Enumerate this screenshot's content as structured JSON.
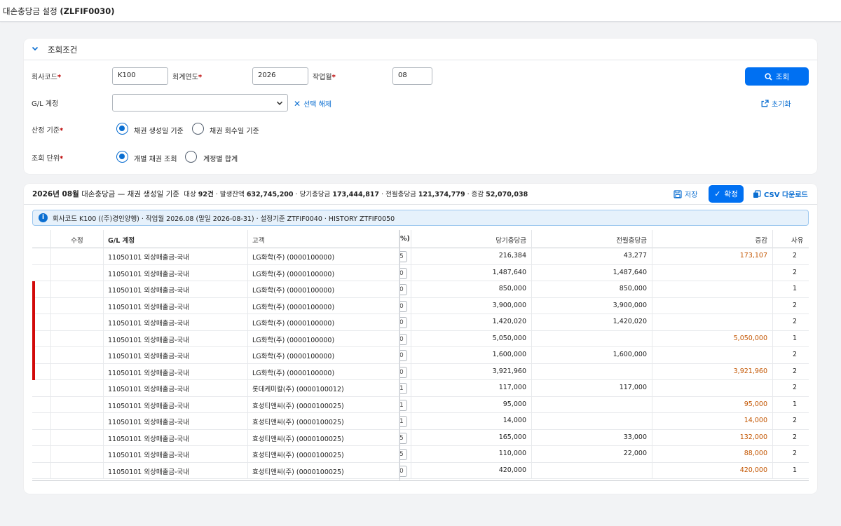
{
  "shell": {
    "title": "대손충당금 설정",
    "code": "(ZLFIF0030)"
  },
  "filter": {
    "header": "조회조건",
    "company_label": "회사코드",
    "company_value": "K100",
    "year_label": "회계연도",
    "year_value": "2026",
    "month_label": "작업월",
    "month_value": "08",
    "gl_label": "G/L 계정",
    "gl_value": "",
    "clear_label": "선택 해제",
    "search_label": "조회",
    "reset_label": "초기화",
    "basis_label": "산정 기준",
    "basis_options": [
      "채권 생성일 기준",
      "채권 회수일 기준"
    ],
    "basis_selected": 0,
    "unit_label": "조회 단위",
    "unit_options": [
      "개별 채권 조회",
      "계정별 합계"
    ],
    "unit_selected": 0
  },
  "result": {
    "title_month": "2026년 08월",
    "title_rest": " 대손충당금 — 채권 생성일 기준",
    "summary": [
      {
        "label": "대상",
        "value": "92건"
      },
      {
        "label": "발생잔액",
        "value": "632,745,200"
      },
      {
        "label": "당기충당금",
        "value": "173,444,817"
      },
      {
        "label": "전월충당금",
        "value": "121,374,779"
      },
      {
        "label": "증감",
        "value": "52,070,038"
      }
    ],
    "save_label": "저장",
    "confirm_label": "확정",
    "csv_label": "CSV 다운로드",
    "info": "회사코드 K100 ((주)경인양행) · 작업월 2026.08 (말일 2026-08-31) · 설정기준 ZTFIF0040 · HISTORY ZTFIF0050",
    "columns": {
      "edit": "수정",
      "gl": "G/L 계정",
      "customer": "고객",
      "pct": "%)",
      "current": "당기충당금",
      "prev": "전월충당금",
      "diff": "증감",
      "reason": "사유"
    },
    "rows": [
      {
        "gl": "11050101 외상매출금-국내",
        "customer": "LG화학(주) (0000100000)",
        "pct": "5",
        "current": "216,384",
        "prev": "43,277",
        "diff": "173,107",
        "reason": "2",
        "flag": false
      },
      {
        "gl": "11050101 외상매출금-국내",
        "customer": "LG화학(주) (0000100000)",
        "pct": "0",
        "current": "1,487,640",
        "prev": "1,487,640",
        "diff": "",
        "reason": "2",
        "flag": false
      },
      {
        "gl": "11050101 외상매출금-국내",
        "customer": "LG화학(주) (0000100000)",
        "pct": "0",
        "current": "850,000",
        "prev": "850,000",
        "diff": "",
        "reason": "1",
        "flag": true
      },
      {
        "gl": "11050101 외상매출금-국내",
        "customer": "LG화학(주) (0000100000)",
        "pct": "0",
        "current": "3,900,000",
        "prev": "3,900,000",
        "diff": "",
        "reason": "2",
        "flag": true
      },
      {
        "gl": "11050101 외상매출금-국내",
        "customer": "LG화학(주) (0000100000)",
        "pct": "0",
        "current": "1,420,020",
        "prev": "1,420,020",
        "diff": "",
        "reason": "2",
        "flag": true
      },
      {
        "gl": "11050101 외상매출금-국내",
        "customer": "LG화학(주) (0000100000)",
        "pct": "0",
        "current": "5,050,000",
        "prev": "",
        "diff": "5,050,000",
        "reason": "1",
        "flag": true
      },
      {
        "gl": "11050101 외상매출금-국내",
        "customer": "LG화학(주) (0000100000)",
        "pct": "0",
        "current": "1,600,000",
        "prev": "1,600,000",
        "diff": "",
        "reason": "2",
        "flag": true
      },
      {
        "gl": "11050101 외상매출금-국내",
        "customer": "LG화학(주) (0000100000)",
        "pct": "0",
        "current": "3,921,960",
        "prev": "",
        "diff": "3,921,960",
        "reason": "2",
        "flag": true
      },
      {
        "gl": "11050101 외상매출금-국내",
        "customer": "롯데케미칼(주) (0000100012)",
        "pct": "1",
        "current": "117,000",
        "prev": "117,000",
        "diff": "",
        "reason": "2",
        "flag": false
      },
      {
        "gl": "11050101 외상매출금-국내",
        "customer": "효성티앤씨(주) (0000100025)",
        "pct": "1",
        "current": "95,000",
        "prev": "",
        "diff": "95,000",
        "reason": "1",
        "flag": false
      },
      {
        "gl": "11050101 외상매출금-국내",
        "customer": "효성티앤씨(주) (0000100025)",
        "pct": "1",
        "current": "14,000",
        "prev": "",
        "diff": "14,000",
        "reason": "2",
        "flag": false
      },
      {
        "gl": "11050101 외상매출금-국내",
        "customer": "효성티앤씨(주) (0000100025)",
        "pct": "5",
        "current": "165,000",
        "prev": "33,000",
        "diff": "132,000",
        "reason": "2",
        "flag": false
      },
      {
        "gl": "11050101 외상매출금-국내",
        "customer": "효성티앤씨(주) (0000100025)",
        "pct": "5",
        "current": "110,000",
        "prev": "22,000",
        "diff": "88,000",
        "reason": "2",
        "flag": false
      },
      {
        "gl": "11050101 외상매출금-국내",
        "customer": "효성티앤씨(주) (0000100025)",
        "pct": "0",
        "current": "420,000",
        "prev": "",
        "diff": "420,000",
        "reason": "1",
        "flag": false
      }
    ]
  },
  "colors": {
    "accent": "#0070f2",
    "link": "#0a6ed1",
    "marker": "#d20a0a",
    "increase": "#c35500"
  }
}
